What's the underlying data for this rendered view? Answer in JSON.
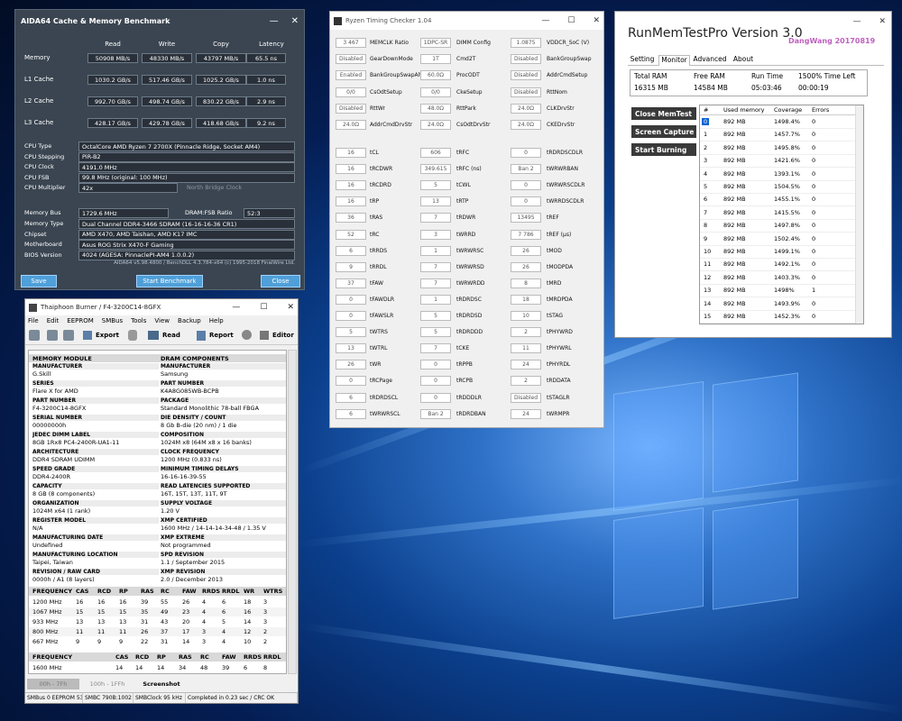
{
  "aida64": {
    "title": "AIDA64 Cache & Memory Benchmark",
    "columns": [
      "Read",
      "Write",
      "Copy",
      "Latency"
    ],
    "rows": [
      {
        "label": "Memory",
        "values": [
          "50908 MB/s",
          "48330 MB/s",
          "43797 MB/s",
          "65.5 ns"
        ]
      },
      {
        "label": "L1 Cache",
        "values": [
          "1030.2 GB/s",
          "517.46 GB/s",
          "1025.2 GB/s",
          "1.0 ns"
        ]
      },
      {
        "label": "L2 Cache",
        "values": [
          "992.70 GB/s",
          "498.74 GB/s",
          "830.22 GB/s",
          "2.9 ns"
        ]
      },
      {
        "label": "L3 Cache",
        "values": [
          "428.17 GB/s",
          "429.78 GB/s",
          "418.68 GB/s",
          "9.2 ns"
        ]
      }
    ],
    "cpu": [
      {
        "label": "CPU Type",
        "value": "OctalCore AMD Ryzen 7 2700X  (Pinnacle Ridge, Socket AM4)"
      },
      {
        "label": "CPU Stepping",
        "value": "PiR-B2"
      },
      {
        "label": "CPU Clock",
        "value": "4191.0 MHz"
      },
      {
        "label": "CPU FSB",
        "value": "99.8 MHz  (original: 100 MHz)"
      },
      {
        "label": "CPU Multiplier",
        "value": "42x"
      }
    ],
    "north_bridge_label": "North Bridge Clock",
    "memory_bus": {
      "label": "Memory Bus",
      "value": "1729.6 MHz",
      "ratio_label": "DRAM:FSB Ratio",
      "ratio": "52:3"
    },
    "system": [
      {
        "label": "Memory Type",
        "value": "Dual Channel DDR4-3466 SDRAM  (16-16-16-36 CR1)"
      },
      {
        "label": "Chipset",
        "value": "AMD X470, AMD Taishan, AMD K17 IMC"
      },
      {
        "label": "Motherboard",
        "value": "Asus ROG Strix X470-F Gaming"
      },
      {
        "label": "BIOS Version",
        "value": "4024  (AGESA: PinnaclePI-AM4 1.0.0.2)"
      }
    ],
    "footer": "AIDA64 v5.98.4800 / BenchDLL 4.3.784-x64  (c) 1995-2018 FinalWire Ltd.",
    "buttons": {
      "save": "Save",
      "start": "Start Benchmark",
      "close": "Close"
    }
  },
  "rtc": {
    "title": "Ryzen Timing Checker 1.04",
    "top": [
      [
        {
          "v": "3 467",
          "l": "MEMCLK Ratio"
        },
        {
          "v": "1DPC-SR",
          "l": "DIMM Config"
        },
        {
          "v": "1.0875",
          "l": "VDDCR_SoC (V)"
        }
      ],
      [
        {
          "v": "Disabled",
          "l": "GearDownMode"
        },
        {
          "v": "1T",
          "l": "Cmd2T"
        },
        {
          "v": "Disabled",
          "l": "BankGroupSwap"
        }
      ],
      [
        {
          "v": "Enabled",
          "l": "BankGroupSwapAlt"
        },
        {
          "v": "60.0Ω",
          "l": "ProcODT"
        },
        {
          "v": "Disabled",
          "l": "AddrCmdSetup"
        }
      ],
      [
        {
          "v": "0/0",
          "l": "CsOdtSetup"
        },
        {
          "v": "0/0",
          "l": "CkeSetup"
        },
        {
          "v": "Disabled",
          "l": "RttNom"
        }
      ],
      [
        {
          "v": "Disabled",
          "l": "RttWr"
        },
        {
          "v": "48.0Ω",
          "l": "RttPark"
        },
        {
          "v": "24.0Ω",
          "l": "CLKDrvStr"
        }
      ],
      [
        {
          "v": "24.0Ω",
          "l": "AddrCmdDrvStr"
        },
        {
          "v": "24.0Ω",
          "l": "CsOdtDrvStr"
        },
        {
          "v": "24.0Ω",
          "l": "CKEDrvStr"
        }
      ]
    ],
    "timings": [
      [
        {
          "v": "16",
          "l": "tCL"
        },
        {
          "v": "606",
          "l": "tRFC"
        },
        {
          "v": "0",
          "l": "tRDRDSCDLR"
        }
      ],
      [
        {
          "v": "16",
          "l": "tRCDWR"
        },
        {
          "v": "349.615",
          "l": "tRFC (ns)"
        },
        {
          "v": "Ban 2",
          "l": "tWRWRBAN"
        }
      ],
      [
        {
          "v": "16",
          "l": "tRCDRD"
        },
        {
          "v": "5",
          "l": "tCWL"
        },
        {
          "v": "0",
          "l": "tWRWRSCDLR"
        }
      ],
      [
        {
          "v": "16",
          "l": "tRP"
        },
        {
          "v": "13",
          "l": "tRTP"
        },
        {
          "v": "0",
          "l": "tWRRDSCDLR"
        }
      ],
      [
        {
          "v": "36",
          "l": "tRAS"
        },
        {
          "v": "7",
          "l": "tRDWR"
        },
        {
          "v": "13495",
          "l": "tREF"
        }
      ],
      [
        {
          "v": "52",
          "l": "tRC"
        },
        {
          "v": "3",
          "l": "tWRRD"
        },
        {
          "v": "7 786",
          "l": "tREF (μs)"
        }
      ],
      [
        {
          "v": "6",
          "l": "tRRDS"
        },
        {
          "v": "1",
          "l": "tWRWRSC"
        },
        {
          "v": "26",
          "l": "tMOD"
        }
      ],
      [
        {
          "v": "9",
          "l": "tRRDL"
        },
        {
          "v": "7",
          "l": "tWRWRSD"
        },
        {
          "v": "26",
          "l": "tMODPDA"
        }
      ],
      [
        {
          "v": "37",
          "l": "tFAW"
        },
        {
          "v": "7",
          "l": "tWRWRDD"
        },
        {
          "v": "8",
          "l": "tMRD"
        }
      ],
      [
        {
          "v": "0",
          "l": "tFAWDLR"
        },
        {
          "v": "1",
          "l": "tRDRDSC"
        },
        {
          "v": "18",
          "l": "tMRDPDA"
        }
      ],
      [
        {
          "v": "0",
          "l": "tFAWSLR"
        },
        {
          "v": "5",
          "l": "tRDRDSD"
        },
        {
          "v": "10",
          "l": "tSTAG"
        }
      ],
      [
        {
          "v": "5",
          "l": "tWTRS"
        },
        {
          "v": "5",
          "l": "tRDRDDD"
        },
        {
          "v": "2",
          "l": "tPHYWRD"
        }
      ],
      [
        {
          "v": "13",
          "l": "tWTRL"
        },
        {
          "v": "7",
          "l": "tCKE"
        },
        {
          "v": "11",
          "l": "tPHYWRL"
        }
      ],
      [
        {
          "v": "26",
          "l": "tWR"
        },
        {
          "v": "0",
          "l": "tRPPB"
        },
        {
          "v": "24",
          "l": "tPHYRDL"
        }
      ],
      [
        {
          "v": "0",
          "l": "tRCPage"
        },
        {
          "v": "0",
          "l": "tRCPB"
        },
        {
          "v": "2",
          "l": "tRDDATA"
        }
      ],
      [
        {
          "v": "6",
          "l": "tRDRDSCL"
        },
        {
          "v": "0",
          "l": "tRDDDLR"
        },
        {
          "v": "Disabled",
          "l": "tSTAGLR"
        }
      ],
      [
        {
          "v": "6",
          "l": "tWRWRSCL"
        },
        {
          "v": "Ban 2",
          "l": "tRDRDBAN"
        },
        {
          "v": "24",
          "l": "tWRMPR"
        }
      ]
    ]
  },
  "rmt": {
    "title": "RunMemTestPro Version 3.0",
    "author": "DangWang  20170819",
    "tabs": [
      "Setting",
      "Monitor",
      "Advanced",
      "About"
    ],
    "stats_headers": [
      "Total RAM",
      "Free RAM",
      "Run Time",
      "1500% Time Left"
    ],
    "stats_values": [
      "16315 MB",
      "14584 MB",
      "05:03:46",
      "00:00:19"
    ],
    "buttons": [
      "Close MemTest",
      "Screen Capture",
      "Start Burning"
    ],
    "table_headers": [
      "#",
      "Used memory",
      "Coverage",
      "Errors"
    ],
    "rows": [
      [
        "0",
        "892 MB",
        "1498.4%",
        "0"
      ],
      [
        "1",
        "892 MB",
        "1457.7%",
        "0"
      ],
      [
        "2",
        "892 MB",
        "1495.8%",
        "0"
      ],
      [
        "3",
        "892 MB",
        "1421.6%",
        "0"
      ],
      [
        "4",
        "892 MB",
        "1393.1%",
        "0"
      ],
      [
        "5",
        "892 MB",
        "1504.5%",
        "0"
      ],
      [
        "6",
        "892 MB",
        "1455.1%",
        "0"
      ],
      [
        "7",
        "892 MB",
        "1415.5%",
        "0"
      ],
      [
        "8",
        "892 MB",
        "1497.8%",
        "0"
      ],
      [
        "9",
        "892 MB",
        "1502.4%",
        "0"
      ],
      [
        "10",
        "892 MB",
        "1499.1%",
        "0"
      ],
      [
        "11",
        "892 MB",
        "1492.1%",
        "0"
      ],
      [
        "12",
        "892 MB",
        "1403.3%",
        "0"
      ],
      [
        "13",
        "892 MB",
        "1498%",
        "1"
      ],
      [
        "14",
        "892 MB",
        "1493.9%",
        "0"
      ],
      [
        "15",
        "892 MB",
        "1452.3%",
        "0"
      ]
    ],
    "selected_row": 0
  },
  "thaiphoon": {
    "title": "Thaiphoon Burner / F4-3200C14-8GFX",
    "menu": [
      "File",
      "Edit",
      "EEPROM",
      "SMBus",
      "Tools",
      "View",
      "Backup",
      "Help"
    ],
    "toolbar": {
      "export": "Export",
      "read": "Read",
      "report": "Report",
      "editor": "Editor"
    },
    "col_headers": [
      "MEMORY MODULE",
      "DRAM COMPONENTS"
    ],
    "fields": [
      [
        {
          "k": "MANUFACTURER",
          "v": "G.Skill"
        },
        {
          "k": "MANUFACTURER",
          "v": "Samsung"
        }
      ],
      [
        {
          "k": "SERIES",
          "v": "Flare X for AMD"
        },
        {
          "k": "PART NUMBER",
          "v": "K4A8G085WB-BCPB"
        }
      ],
      [
        {
          "k": "PART NUMBER",
          "v": "F4-3200C14-8GFX"
        },
        {
          "k": "PACKAGE",
          "v": "Standard Monolithic 78-ball FBGA"
        }
      ],
      [
        {
          "k": "SERIAL NUMBER",
          "v": "00000000h"
        },
        {
          "k": "DIE DENSITY / COUNT",
          "v": "8 Gb B-die (20 nm) / 1 die"
        }
      ],
      [
        {
          "k": "JEDEC DIMM LABEL",
          "v": "8GB 1Rx8 PC4-2400R-UA1-11"
        },
        {
          "k": "COMPOSITION",
          "v": "1024M x8 (64M x8 x 16 banks)"
        }
      ],
      [
        {
          "k": "ARCHITECTURE",
          "v": "DDR4 SDRAM UDIMM"
        },
        {
          "k": "CLOCK FREQUENCY",
          "v": "1200 MHz (0.833 ns)"
        }
      ],
      [
        {
          "k": "SPEED GRADE",
          "v": "DDR4-2400R"
        },
        {
          "k": "MINIMUM TIMING DELAYS",
          "v": "16-16-16-39-55"
        }
      ],
      [
        {
          "k": "CAPACITY",
          "v": "8 GB (8 components)"
        },
        {
          "k": "READ LATENCIES SUPPORTED",
          "v": "16T, 15T, 13T, 11T, 9T"
        }
      ],
      [
        {
          "k": "ORGANIZATION",
          "v": "1024M x64 (1 rank)"
        },
        {
          "k": "SUPPLY VOLTAGE",
          "v": "1.20 V"
        }
      ],
      [
        {
          "k": "REGISTER MODEL",
          "v": "N/A"
        },
        {
          "k": "XMP CERTIFIED",
          "v": "1600 MHz / 14-14-14-34-48 / 1.35 V"
        }
      ],
      [
        {
          "k": "MANUFACTURING DATE",
          "v": "Undefined"
        },
        {
          "k": "XMP EXTREME",
          "v": "Not programmed"
        }
      ],
      [
        {
          "k": "MANUFACTURING LOCATION",
          "v": "Taipei, Taiwan"
        },
        {
          "k": "SPD REVISION",
          "v": "1.1 / September 2015"
        }
      ],
      [
        {
          "k": "REVISION / RAW CARD",
          "v": "0000h / A1 (8 layers)"
        },
        {
          "k": "XMP REVISION",
          "v": "2.0 / December 2013"
        }
      ]
    ],
    "freq_headers": [
      "FREQUENCY",
      "CAS",
      "RCD",
      "RP",
      "RAS",
      "RC",
      "FAW",
      "RRDS",
      "RRDL",
      "WR",
      "WTRS"
    ],
    "freq_rows": [
      [
        "1200 MHz",
        "16",
        "16",
        "16",
        "39",
        "55",
        "26",
        "4",
        "6",
        "18",
        "3"
      ],
      [
        "1067 MHz",
        "15",
        "15",
        "15",
        "35",
        "49",
        "23",
        "4",
        "6",
        "16",
        "3"
      ],
      [
        "933 MHz",
        "13",
        "13",
        "13",
        "31",
        "43",
        "20",
        "4",
        "5",
        "14",
        "3"
      ],
      [
        "800 MHz",
        "11",
        "11",
        "11",
        "26",
        "37",
        "17",
        "3",
        "4",
        "12",
        "2"
      ],
      [
        "667 MHz",
        "9",
        "9",
        "9",
        "22",
        "31",
        "14",
        "3",
        "4",
        "10",
        "2"
      ]
    ],
    "xmp_headers": [
      "FREQUENCY",
      "CAS",
      "RCD",
      "RP",
      "RAS",
      "RC",
      "FAW",
      "RRDS",
      "RRDL"
    ],
    "xmp_rows": [
      [
        "1600 MHz",
        "14",
        "14",
        "14",
        "34",
        "48",
        "39",
        "6",
        "8"
      ]
    ],
    "bottom_buttons": [
      "00h - 7Fh",
      "100h - 1FFh",
      "Screenshot"
    ],
    "status": [
      "SMBus 0 EEPROM 53h",
      "SMBC 790B:1002",
      "SMBClock 95 kHz",
      "Completed in 0.23 sec / CRC OK"
    ]
  }
}
